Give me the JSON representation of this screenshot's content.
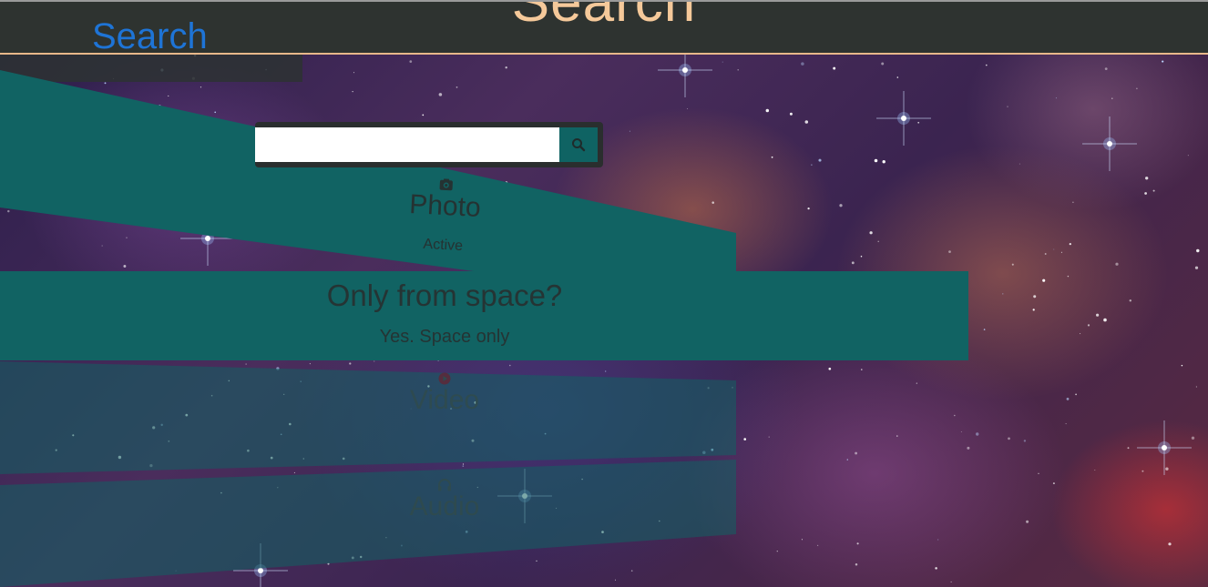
{
  "header": {
    "title": "Search",
    "nav_link": "Search"
  },
  "search": {
    "value": "",
    "placeholder": "",
    "button_icon": "search-icon"
  },
  "categories": [
    {
      "label": "Photo",
      "status": "Active",
      "icon": "camera-icon"
    },
    {
      "label": "Video",
      "status": "",
      "icon": "video-icon"
    },
    {
      "label": "Audio",
      "status": "",
      "icon": "headphones-icon"
    }
  ],
  "banner": {
    "heading": "Only from space?",
    "subtext": "Yes. Space only"
  },
  "colors": {
    "header_bg": "#2e3330",
    "header_title": "#f5c99a",
    "link": "#1e74d6",
    "panel_teal": "#116363"
  }
}
